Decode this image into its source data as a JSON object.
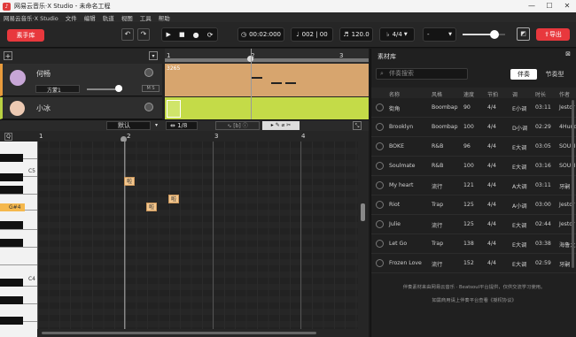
{
  "titlebar": {
    "title": "网易云音乐·X Studio - 未命名工程",
    "min": "—",
    "max": "☐",
    "close": "✕"
  },
  "menu": [
    "网易云音乐·X Studio",
    "文件",
    "编辑",
    "轨道",
    "视图",
    "工具",
    "帮助"
  ],
  "toolbar": {
    "lib_button": "素手库",
    "time": "00:02:000",
    "bar_beat": "002 | 00",
    "tempo": "120.0",
    "timesig": "4/4",
    "key": "-",
    "export": "导出"
  },
  "tracks": [
    {
      "name": "何畅",
      "instrument": "方蒙1",
      "region_label": "3265"
    },
    {
      "name": "小冰"
    }
  ],
  "timeline": {
    "marks": [
      "1",
      "2",
      "3"
    ]
  },
  "editor": {
    "preset": "默认",
    "quant": "1/8",
    "marks": [
      "1",
      "2",
      "3",
      "4"
    ],
    "keys": [
      "C5",
      "G#4",
      "C4"
    ],
    "notes": [
      "啦",
      "啦",
      "啦"
    ]
  },
  "library": {
    "title": "素材库",
    "search_placeholder": "伴奏搜索",
    "tabs": [
      "伴奏",
      "节奏型"
    ],
    "columns": [
      "名称",
      "风格",
      "速度",
      "节拍",
      "调",
      "时长",
      "作者"
    ],
    "rows": [
      [
        "街角",
        "Boombap",
        "90",
        "4/4",
        "E小调",
        "03:11",
        "Jestor"
      ],
      [
        "Brooklyn",
        "Boombap",
        "100",
        "4/4",
        "D小调",
        "02:29",
        "4Hund"
      ],
      [
        "BOKE",
        "R&B",
        "96",
        "4/4",
        "E大调",
        "03:05",
        "SOULI"
      ],
      [
        "Soulmate",
        "R&B",
        "100",
        "4/4",
        "E大调",
        "03:16",
        "SOULI"
      ],
      [
        "My heart",
        "流行",
        "121",
        "4/4",
        "A大调",
        "03:11",
        "牙嗣"
      ],
      [
        "Riot",
        "Trap",
        "125",
        "4/4",
        "A小调",
        "03:00",
        "Jestor"
      ],
      [
        "Julie",
        "流行",
        "125",
        "4/4",
        "E大调",
        "02:44",
        "Jestor"
      ],
      [
        "Let Go",
        "Trap",
        "138",
        "4/4",
        "E大调",
        "03:38",
        "海鲁之"
      ],
      [
        "Frozen Love",
        "流行",
        "152",
        "4/4",
        "E大调",
        "02:59",
        "牙嗣"
      ]
    ],
    "footer1": "伴奏素材来由网易云音乐 · Beatsoul平台提供，仅供交流学习使用。",
    "footer2": "如需商用请上伴奏平台查看《授权协议》"
  }
}
